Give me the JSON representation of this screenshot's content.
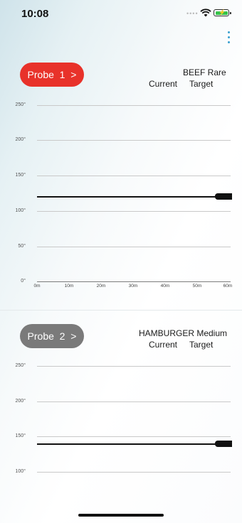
{
  "status": {
    "time": "10:08",
    "battery_color": "#36c24a"
  },
  "menu_icon": "more-vertical-icon",
  "probes": [
    {
      "button_label": "Probe  1  >",
      "button_color": "#e8322a",
      "meat": "BEEF Rare",
      "current_label": "Current",
      "target_label": "Target",
      "y_ticks": [
        "250°",
        "200°",
        "150°",
        "100°",
        "50°",
        "0°"
      ],
      "x_ticks": [
        "0m",
        "10m",
        "20m",
        "30m",
        "40m",
        "50m",
        "60m"
      ],
      "temperature_line_value": 120
    },
    {
      "button_label": "Probe  2  >",
      "button_color": "#7a7a7a",
      "meat": "HAMBURGER Medium",
      "current_label": "Current",
      "target_label": "Target",
      "y_ticks": [
        "250°",
        "200°",
        "150°",
        "100°"
      ],
      "temperature_line_value": 140
    }
  ]
}
